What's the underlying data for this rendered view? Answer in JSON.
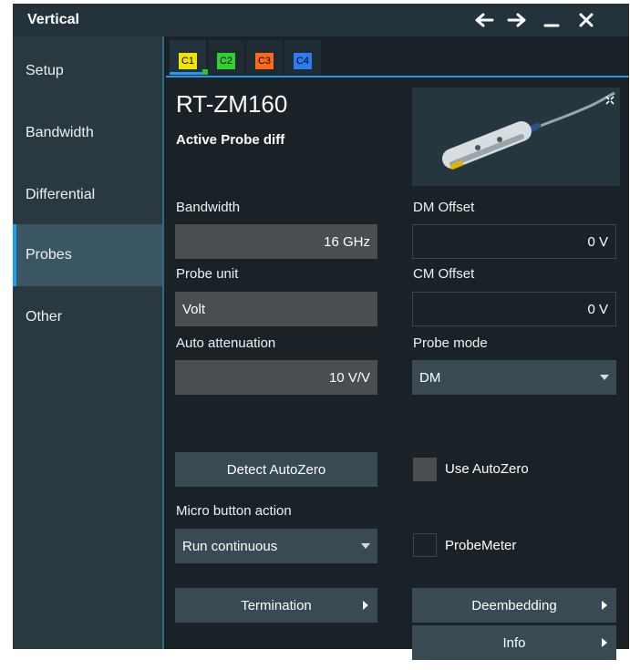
{
  "window": {
    "title": "Vertical"
  },
  "titlebar": {
    "back_icon": "arrow-left-icon",
    "forward_icon": "arrow-right-icon",
    "minimize_icon": "minimize-icon",
    "close_icon": "close-icon"
  },
  "sidebar": {
    "items": [
      {
        "label": "Setup"
      },
      {
        "label": "Bandwidth"
      },
      {
        "label": "Differential"
      },
      {
        "label": "Probes",
        "active": true
      },
      {
        "label": "Other"
      }
    ]
  },
  "tabs": [
    {
      "label": "C1",
      "color": "#f2e400",
      "active": true
    },
    {
      "label": "C2",
      "color": "#2ed12e"
    },
    {
      "label": "C3",
      "color": "#ff6a1a"
    },
    {
      "label": "C4",
      "color": "#2b7cf0"
    }
  ],
  "probe": {
    "name": "RT-ZM160",
    "type": "Active Probe diff",
    "expand_icon": "expand-icon"
  },
  "fields": {
    "bandwidth": {
      "label": "Bandwidth",
      "value": "16 GHz"
    },
    "probe_unit": {
      "label": "Probe unit",
      "value": "Volt"
    },
    "auto_attenuation": {
      "label": "Auto attenuation",
      "value": "10 V/V"
    },
    "dm_offset": {
      "label": "DM Offset",
      "value": "0 V"
    },
    "cm_offset": {
      "label": "CM Offset",
      "value": "0 V"
    },
    "probe_mode": {
      "label": "Probe mode",
      "value": "DM"
    },
    "micro_button_action": {
      "label": "Micro button action",
      "value": "Run continuous"
    }
  },
  "buttons": {
    "detect_autozero": "Detect AutoZero",
    "termination": "Termination",
    "deembedding": "Deembedding",
    "info": "Info"
  },
  "checkboxes": {
    "use_autozero": {
      "label": "Use AutoZero",
      "checked": false
    },
    "probemeter": {
      "label": "ProbeMeter",
      "checked": false
    }
  },
  "colors": {
    "accent": "#1d9bf0",
    "background": "#1a2227",
    "sidebar": "#2a3840",
    "sidebar_active": "#3a5662"
  }
}
